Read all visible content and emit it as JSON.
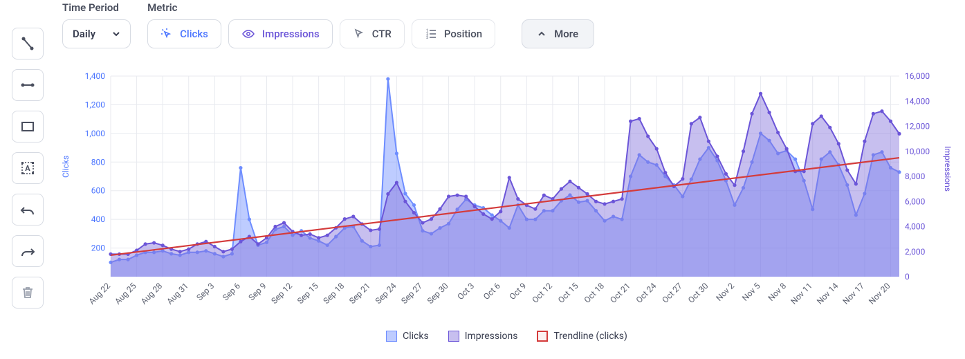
{
  "controls": {
    "time_period_label": "Time Period",
    "time_period_value": "Daily",
    "metric_label": "Metric",
    "metrics": {
      "clicks": "Clicks",
      "impressions": "Impressions",
      "ctr": "CTR",
      "position": "Position"
    },
    "more_label": "More"
  },
  "chart": {
    "y_left_label": "Clicks",
    "y_right_label": "Impressions",
    "legend": {
      "clicks": "Clicks",
      "impressions": "Impressions",
      "trend": "Trendline (clicks)"
    },
    "colors": {
      "clicks_line": "#6e8dff",
      "clicks_fill": "rgba(110,141,255,0.45)",
      "impr_line": "#6b55d8",
      "impr_fill": "rgba(130,112,220,0.45)",
      "trend": "#d43b3b"
    }
  },
  "chart_data": {
    "type": "line",
    "title": "",
    "xlabel": "",
    "ylabel": "Clicks",
    "y2label": "Impressions",
    "ylim": [
      0,
      1400
    ],
    "y2lim": [
      0,
      16000
    ],
    "y_ticks": [
      200,
      400,
      600,
      800,
      1000,
      1200,
      1400
    ],
    "y2_ticks": [
      0,
      2000,
      4000,
      6000,
      8000,
      10000,
      12000,
      14000,
      16000
    ],
    "x_tick_labels": [
      "Aug 22",
      "Aug 25",
      "Aug 28",
      "Aug 31",
      "Sep 3",
      "Sep 6",
      "Sep 9",
      "Sep 12",
      "Sep 15",
      "Sep 18",
      "Sep 21",
      "Sep 24",
      "Sep 27",
      "Sep 30",
      "Oct 3",
      "Oct 6",
      "Oct 9",
      "Oct 12",
      "Oct 15",
      "Oct 18",
      "Oct 21",
      "Oct 24",
      "Oct 27",
      "Oct 30",
      "Nov 2",
      "Nov 5",
      "Nov 8",
      "Nov 11",
      "Nov 14",
      "Nov 17",
      "Nov 20"
    ],
    "x": [
      "Aug 22",
      "Aug 23",
      "Aug 24",
      "Aug 25",
      "Aug 26",
      "Aug 27",
      "Aug 28",
      "Aug 29",
      "Aug 30",
      "Aug 31",
      "Sep 1",
      "Sep 2",
      "Sep 3",
      "Sep 4",
      "Sep 5",
      "Sep 6",
      "Sep 7",
      "Sep 8",
      "Sep 9",
      "Sep 10",
      "Sep 11",
      "Sep 12",
      "Sep 13",
      "Sep 14",
      "Sep 15",
      "Sep 16",
      "Sep 17",
      "Sep 18",
      "Sep 19",
      "Sep 20",
      "Sep 21",
      "Sep 22",
      "Sep 23",
      "Sep 24",
      "Sep 25",
      "Sep 26",
      "Sep 27",
      "Sep 28",
      "Sep 29",
      "Sep 30",
      "Oct 1",
      "Oct 2",
      "Oct 3",
      "Oct 4",
      "Oct 5",
      "Oct 6",
      "Oct 7",
      "Oct 8",
      "Oct 9",
      "Oct 10",
      "Oct 11",
      "Oct 12",
      "Oct 13",
      "Oct 14",
      "Oct 15",
      "Oct 16",
      "Oct 17",
      "Oct 18",
      "Oct 19",
      "Oct 20",
      "Oct 21",
      "Oct 22",
      "Oct 23",
      "Oct 24",
      "Oct 25",
      "Oct 26",
      "Oct 27",
      "Oct 28",
      "Oct 29",
      "Oct 30",
      "Oct 31",
      "Nov 1",
      "Nov 2",
      "Nov 3",
      "Nov 4",
      "Nov 5",
      "Nov 6",
      "Nov 7",
      "Nov 8",
      "Nov 9",
      "Nov 10",
      "Nov 11",
      "Nov 12",
      "Nov 13",
      "Nov 14",
      "Nov 15",
      "Nov 16",
      "Nov 17",
      "Nov 18",
      "Nov 19",
      "Nov 20",
      "Nov 21"
    ],
    "series": [
      {
        "name": "Clicks",
        "axis": "left",
        "values": [
          100,
          120,
          120,
          150,
          170,
          170,
          180,
          160,
          150,
          170,
          170,
          180,
          160,
          140,
          160,
          760,
          400,
          220,
          240,
          330,
          350,
          290,
          320,
          270,
          250,
          220,
          280,
          340,
          350,
          250,
          210,
          220,
          1380,
          860,
          580,
          500,
          320,
          300,
          340,
          370,
          470,
          540,
          500,
          480,
          430,
          390,
          340,
          500,
          400,
          400,
          460,
          460,
          530,
          570,
          520,
          530,
          460,
          390,
          420,
          400,
          700,
          850,
          800,
          780,
          700,
          640,
          560,
          680,
          820,
          900,
          810,
          670,
          500,
          620,
          800,
          1000,
          950,
          860,
          880,
          820,
          670,
          470,
          820,
          870,
          780,
          640,
          430,
          580,
          850,
          870,
          760,
          730
        ]
      },
      {
        "name": "Impressions",
        "axis": "right",
        "values": [
          1800,
          1800,
          1800,
          2100,
          2600,
          2700,
          2500,
          2200,
          2000,
          2200,
          2600,
          2800,
          2400,
          2000,
          2200,
          2800,
          3200,
          2600,
          3100,
          4000,
          4300,
          3600,
          3300,
          3400,
          3100,
          3300,
          3900,
          4600,
          4800,
          4200,
          3700,
          3800,
          6600,
          7500,
          6000,
          5100,
          4300,
          4600,
          5400,
          6400,
          6500,
          6400,
          5600,
          5000,
          4600,
          5200,
          7900,
          6200,
          5700,
          5400,
          6500,
          6200,
          7000,
          7600,
          7100,
          6600,
          6000,
          5800,
          6000,
          6200,
          12400,
          12600,
          11200,
          10200,
          8300,
          7200,
          7800,
          12200,
          12700,
          10800,
          9600,
          8200,
          7300,
          10000,
          13000,
          14600,
          13100,
          11500,
          10200,
          8400,
          8400,
          12200,
          12800,
          11900,
          10600,
          8500,
          7400,
          10800,
          13000,
          13200,
          12400,
          11400
        ]
      }
    ],
    "trendline": {
      "start": 150,
      "end": 830
    }
  }
}
